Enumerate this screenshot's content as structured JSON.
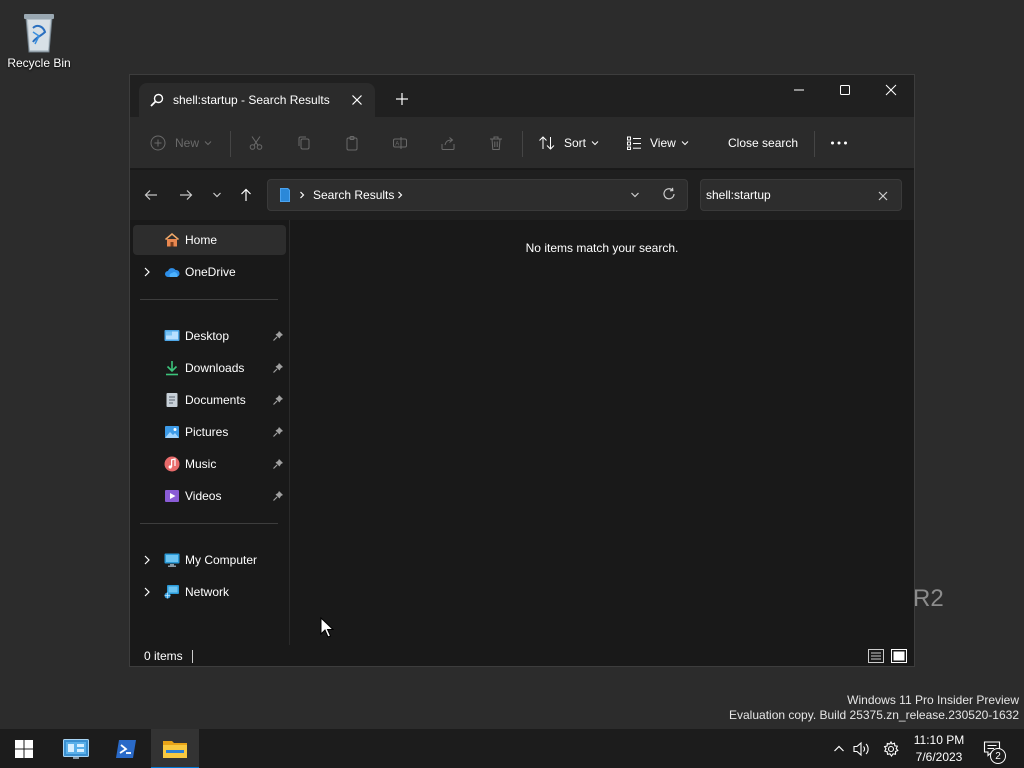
{
  "desktop": {
    "recycle_bin_label": "Recycle Bin",
    "background_text": "R2",
    "watermark_line1": "Windows 11 Pro Insider Preview",
    "watermark_line2": "Evaluation copy. Build 25375.zn_release.230520-1632"
  },
  "window": {
    "tab_title": "shell:startup - Search Results",
    "tab_icon": "search-icon",
    "controls": [
      "minimize",
      "maximize",
      "close"
    ]
  },
  "toolbar": {
    "new_label": "New",
    "sort_label": "Sort",
    "view_label": "View",
    "close_search_label": "Close search",
    "icons": [
      "cut-icon",
      "copy-icon",
      "paste-icon",
      "rename-icon",
      "share-icon",
      "delete-icon",
      "more-icon"
    ]
  },
  "address": {
    "breadcrumb": "Search Results"
  },
  "search": {
    "value": "shell:startup"
  },
  "sidebar": {
    "items": [
      {
        "label": "Home",
        "icon": "home-icon",
        "active": true
      },
      {
        "label": "OneDrive",
        "icon": "onedrive-icon",
        "expandable": true
      },
      {
        "label": "Desktop",
        "icon": "desktop-icon",
        "pinned": true
      },
      {
        "label": "Downloads",
        "icon": "downloads-icon",
        "pinned": true
      },
      {
        "label": "Documents",
        "icon": "documents-icon",
        "pinned": true
      },
      {
        "label": "Pictures",
        "icon": "pictures-icon",
        "pinned": true
      },
      {
        "label": "Music",
        "icon": "music-icon",
        "pinned": true
      },
      {
        "label": "Videos",
        "icon": "videos-icon",
        "pinned": true
      },
      {
        "label": "My Computer",
        "icon": "computer-icon",
        "expandable": true
      },
      {
        "label": "Network",
        "icon": "network-icon",
        "expandable": true
      }
    ]
  },
  "content": {
    "empty_message": "No items match your search."
  },
  "status": {
    "item_count": "0 items"
  },
  "taskbar": {
    "apps": [
      "start-icon",
      "server-manager-icon",
      "powershell-icon",
      "file-explorer-icon"
    ],
    "clock_time": "11:10 PM",
    "clock_date": "7/6/2023",
    "notification_count": "2"
  },
  "colors": {
    "accent": "#0078d4",
    "desktop_bg": "#2c2c2c",
    "window_bg": "#191919",
    "toolbar_bg": "#2b2b2b"
  }
}
